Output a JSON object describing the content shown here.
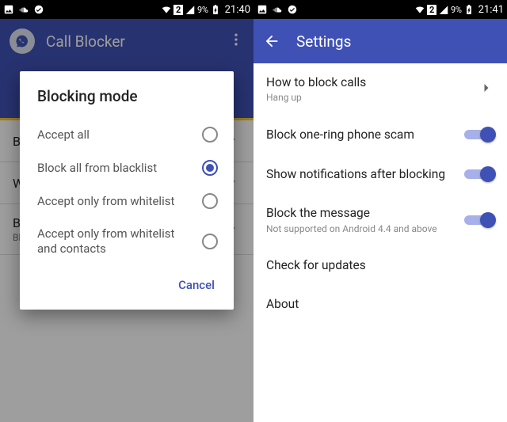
{
  "left": {
    "statusbar": {
      "battery": "9%",
      "time": "21:40",
      "sim": "2"
    },
    "appbar": {
      "title": "Call Blocker"
    },
    "bglist": [
      {
        "title": "Blacklist",
        "sub": ""
      },
      {
        "title": "Whitelist",
        "sub": ""
      },
      {
        "title": "Blocking mode",
        "sub": "Block all from blacklist"
      }
    ],
    "dialog": {
      "title": "Blocking mode",
      "options": [
        {
          "label": "Accept all",
          "checked": false
        },
        {
          "label": "Block all from blacklist",
          "checked": true
        },
        {
          "label": "Accept only from whitelist",
          "checked": false
        },
        {
          "label": "Accept only from whitelist and contacts",
          "checked": false
        }
      ],
      "cancel": "Cancel"
    }
  },
  "right": {
    "statusbar": {
      "battery": "9%",
      "time": "21:41",
      "sim": "2"
    },
    "appbar": {
      "title": "Settings"
    },
    "rows": [
      {
        "title": "How to block calls",
        "sub": "Hang up",
        "type": "nav"
      },
      {
        "title": "Block one-ring phone scam",
        "sub": "",
        "type": "switch",
        "on": true
      },
      {
        "title": "Show notifications after blocking",
        "sub": "",
        "type": "switch",
        "on": true
      },
      {
        "title": "Block the message",
        "sub": "Not supported on Android 4.4 and above",
        "type": "switch",
        "on": true
      },
      {
        "title": "Check for updates",
        "sub": "",
        "type": "plain"
      },
      {
        "title": "About",
        "sub": "",
        "type": "plain"
      }
    ]
  }
}
